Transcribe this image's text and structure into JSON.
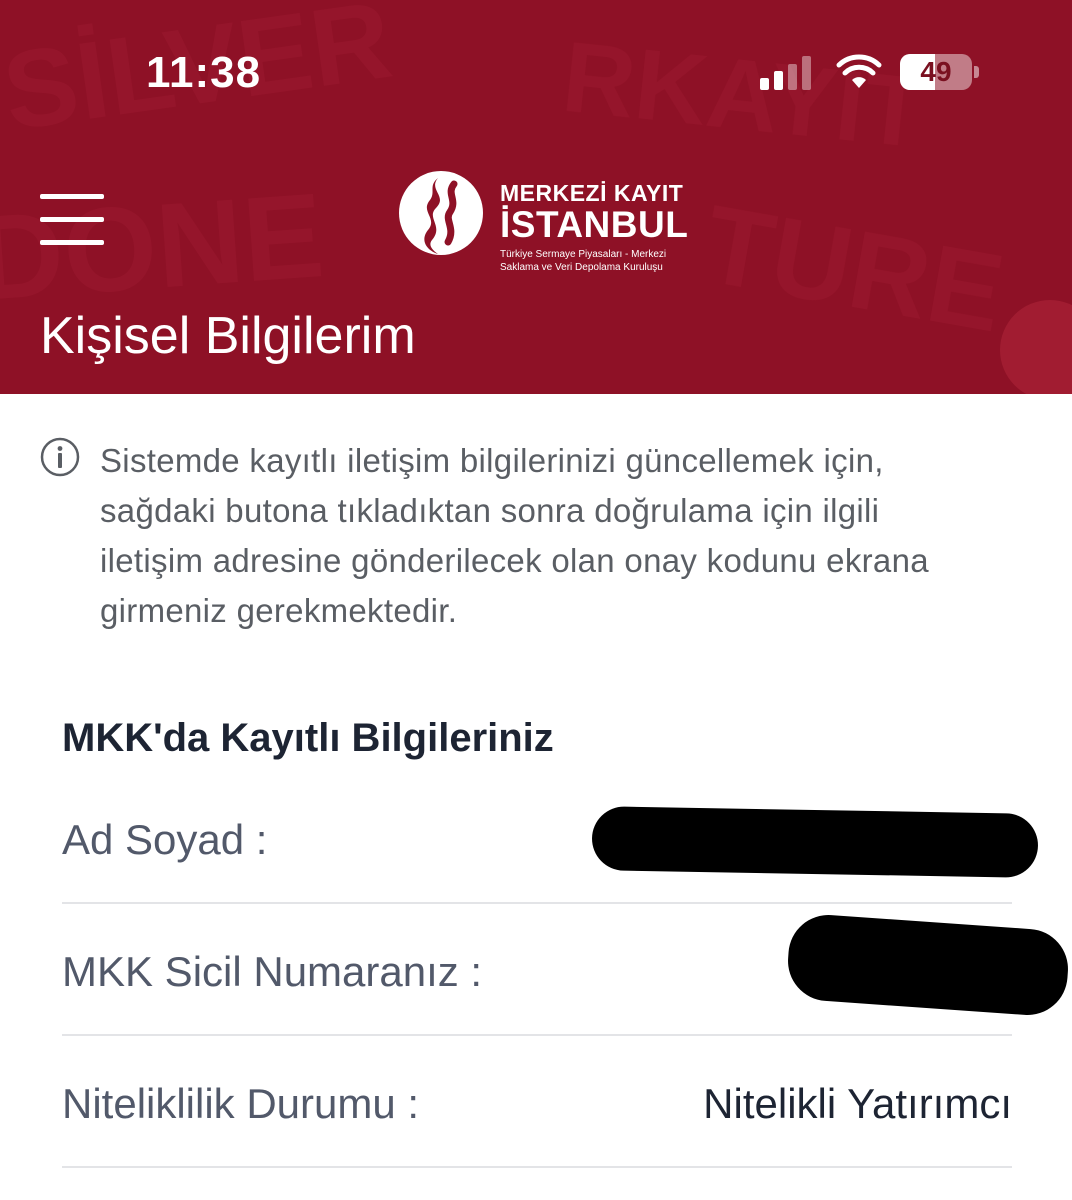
{
  "status_bar": {
    "time": "11:38",
    "battery_level": "49",
    "battery_fraction": 0.49,
    "signal_bars_active": 2,
    "signal_bars_total": 4
  },
  "header": {
    "brand_line1": "MERKEZİ KAYIT",
    "brand_line2": "İSTANBUL",
    "brand_subtitle_1": "Türkiye Sermaye Piyasaları - Merkezi",
    "brand_subtitle_2": "Saklama ve Veri Depolama Kuruluşu",
    "page_title": "Kişisel Bilgilerim",
    "menu_icon": "hamburger-menu-icon"
  },
  "info": {
    "icon": "info-circle-icon",
    "lines": [
      "Sistemde kayıtlı iletişim bilgilerinizi güncellemek için,",
      "sağdaki butona tıkladıktan sonra doğrulama için ilgili",
      "iletişim adresine gönderilecek olan onay kodunu ekrana",
      "girmeniz gerekmektedir."
    ]
  },
  "section": {
    "title": "MKK'da Kayıtlı Bilgileriniz",
    "rows": [
      {
        "label": "Ad Soyad :",
        "value": ""
      },
      {
        "label": "MKK Sicil Numaranız :",
        "value": ""
      },
      {
        "label": "Niteliklilik Durumu :",
        "value": "Nitelikli Yatırımcı"
      }
    ]
  },
  "colors": {
    "header_bg": "#8e1126",
    "text_primary": "#1d2433",
    "text_secondary": "#52596a",
    "divider": "#e3e4e7"
  }
}
